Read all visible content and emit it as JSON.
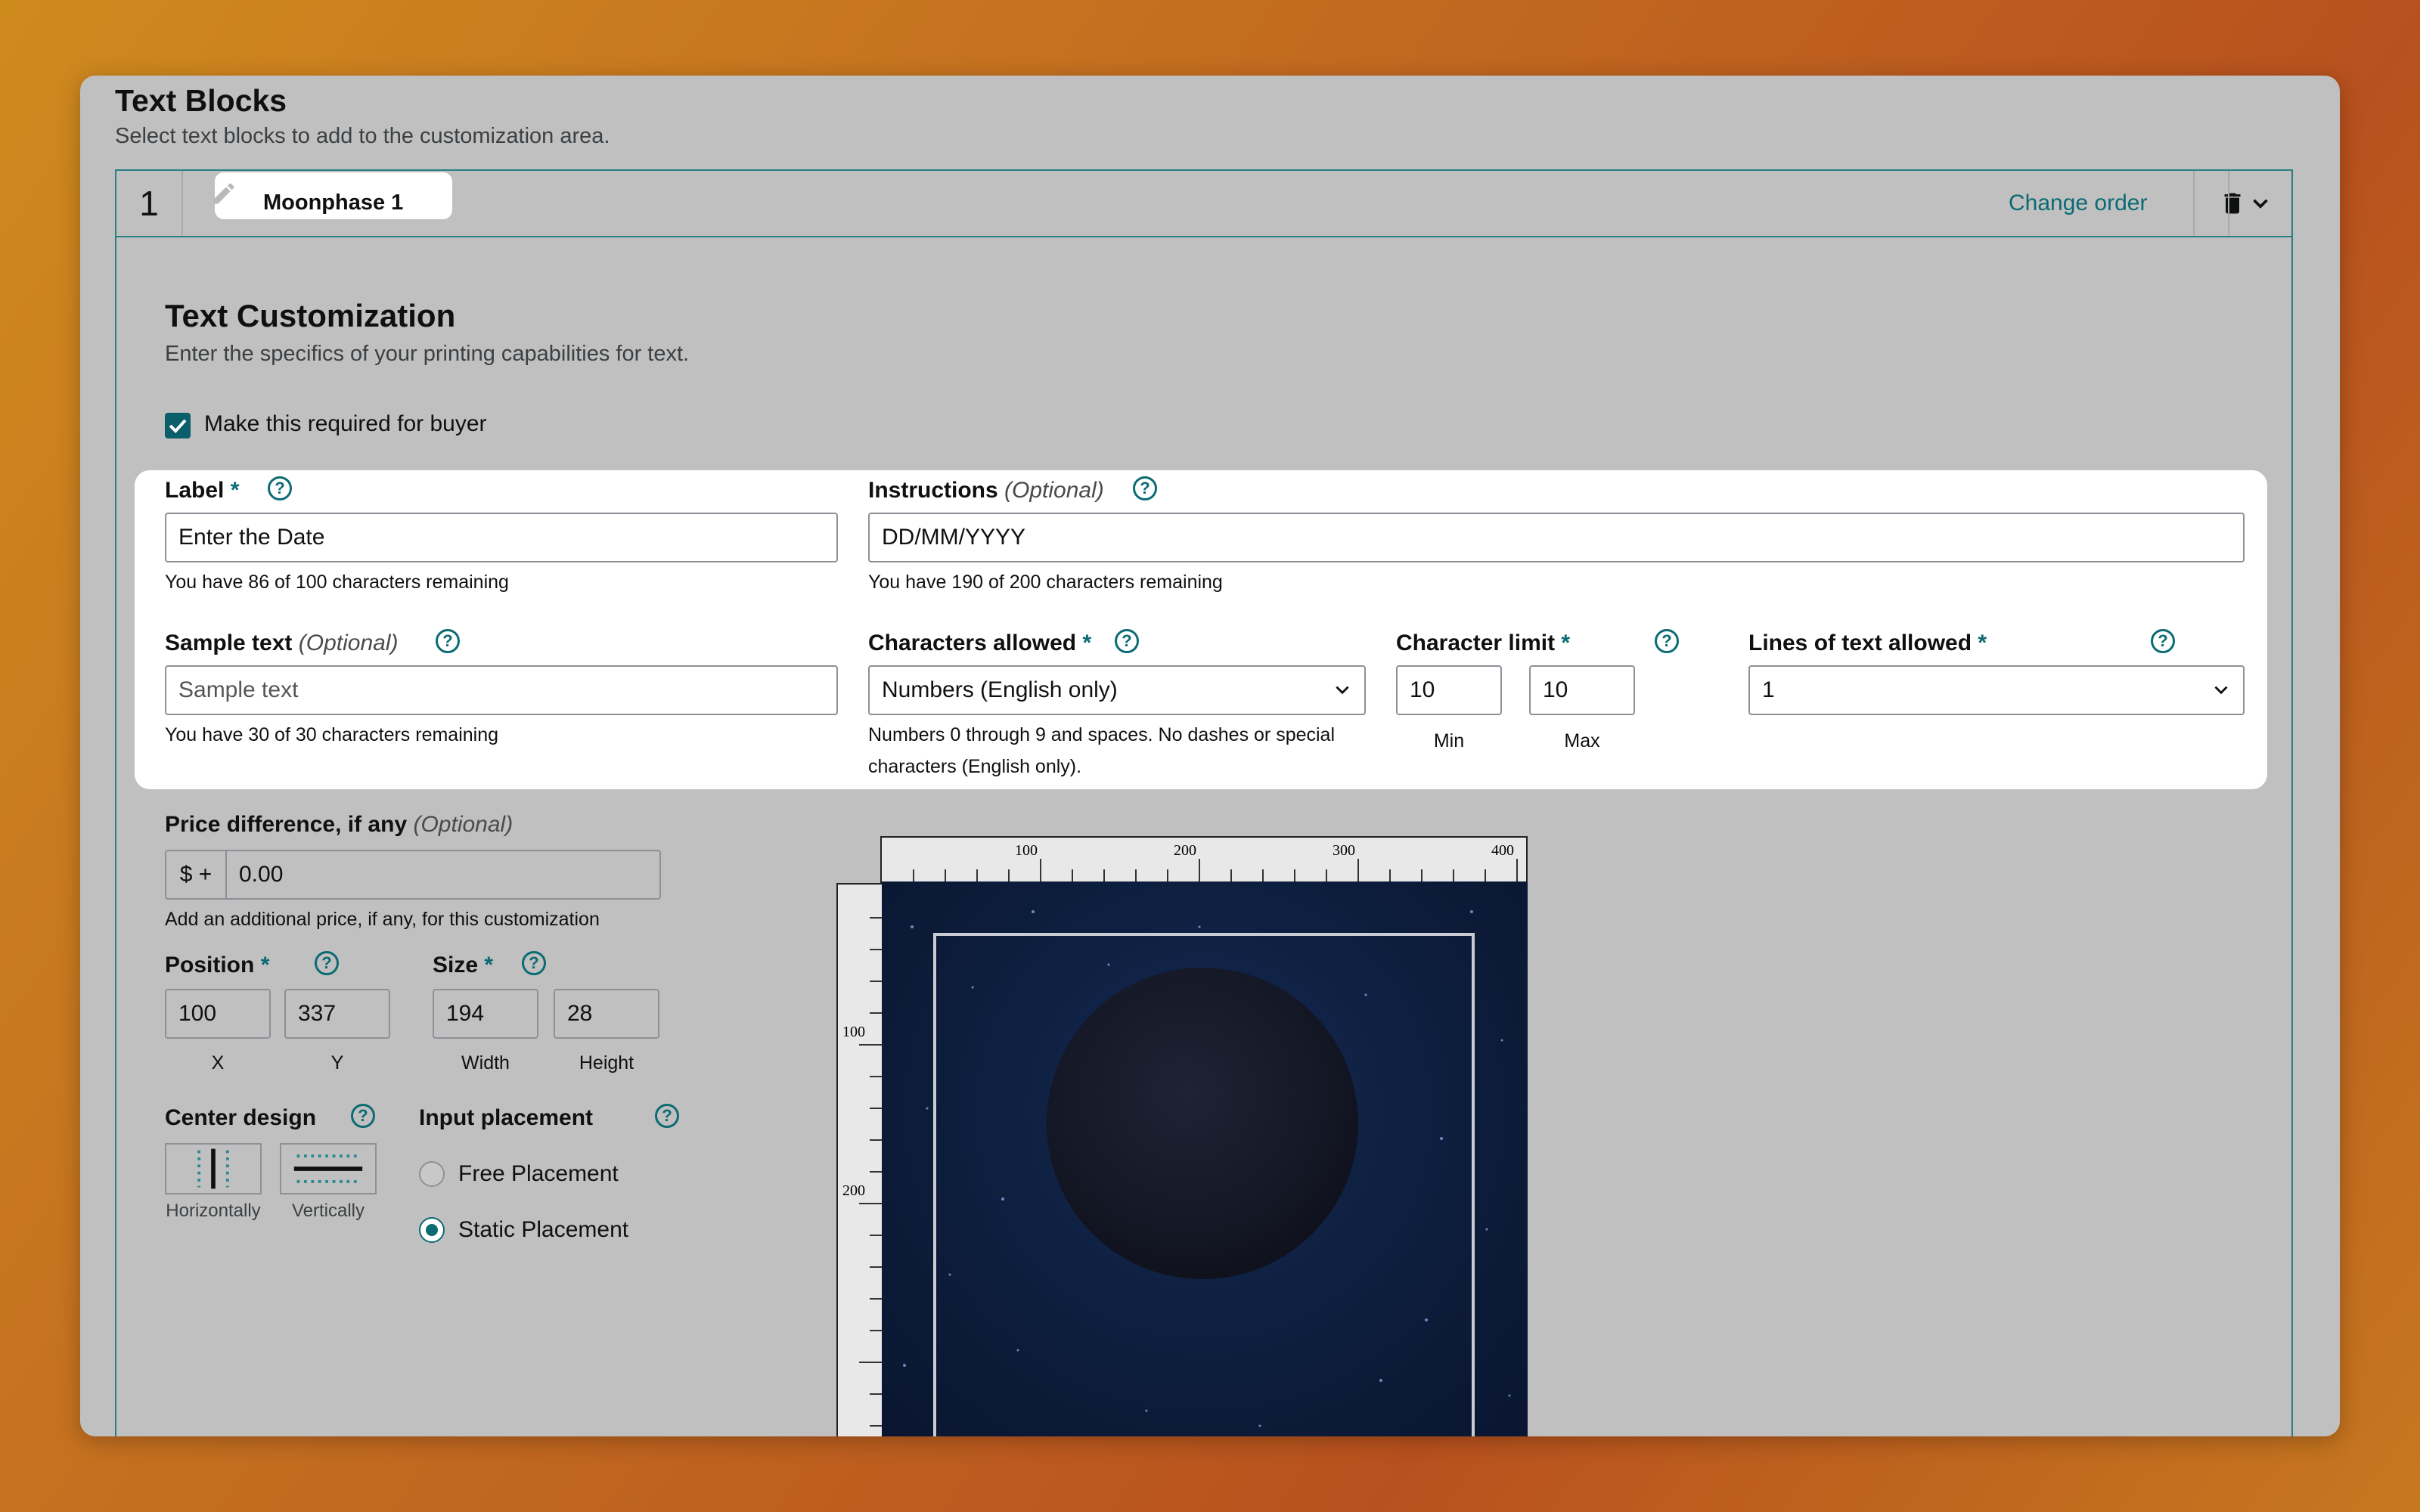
{
  "header": {
    "title": "Text Blocks",
    "subtitle": "Select text blocks to add to the customization area."
  },
  "block": {
    "number": "1",
    "name": "Moonphase 1",
    "change_order": "Change order"
  },
  "section": {
    "title": "Text Customization",
    "subtitle": "Enter the specifics of your printing capabilities for text."
  },
  "required_checkbox": {
    "label": "Make this required for buyer",
    "checked": true
  },
  "fields": {
    "label": {
      "title": "Label",
      "required_mark": "*",
      "value": "Enter the Date",
      "hint": "You have 86 of 100 characters remaining"
    },
    "instructions": {
      "title": "Instructions",
      "optional": "(Optional)",
      "value": "DD/MM/YYYY",
      "hint": "You have 190 of 200 characters remaining"
    },
    "sample_text": {
      "title": "Sample text",
      "optional": "(Optional)",
      "placeholder": "Sample text",
      "hint": "You have 30 of 30 characters remaining"
    },
    "characters_allowed": {
      "title": "Characters allowed",
      "required_mark": "*",
      "value": "Numbers (English only)",
      "hint_line1": "Numbers 0 through 9 and spaces. No dashes or special",
      "hint_line2": "characters (English only)."
    },
    "character_limit": {
      "title": "Character limit",
      "required_mark": "*",
      "min": "10",
      "max": "10",
      "min_label": "Min",
      "max_label": "Max"
    },
    "lines_allowed": {
      "title": "Lines of text allowed",
      "required_mark": "*",
      "value": "1"
    },
    "price": {
      "title": "Price difference, if any",
      "optional": "(Optional)",
      "prefix": "$ +",
      "value": "0.00",
      "hint": "Add an additional price, if any, for this customization"
    },
    "position": {
      "title": "Position",
      "required_mark": "*",
      "x": "100",
      "y": "337",
      "x_label": "X",
      "y_label": "Y"
    },
    "size": {
      "title": "Size",
      "required_mark": "*",
      "width": "194",
      "height": "28",
      "width_label": "Width",
      "height_label": "Height"
    },
    "center_design": {
      "title": "Center design",
      "horizontal_label": "Horizontally",
      "vertical_label": "Vertically"
    },
    "input_placement": {
      "title": "Input placement",
      "options": [
        "Free Placement",
        "Static Placement"
      ],
      "selected": "Static Placement"
    }
  },
  "ruler": {
    "top_labels": [
      "100",
      "200",
      "300",
      "400"
    ],
    "left_labels": [
      "100",
      "200"
    ]
  },
  "help_glyph": "?",
  "colors": {
    "accent": "#0b6b74",
    "canvas": "#0c1c3a"
  }
}
